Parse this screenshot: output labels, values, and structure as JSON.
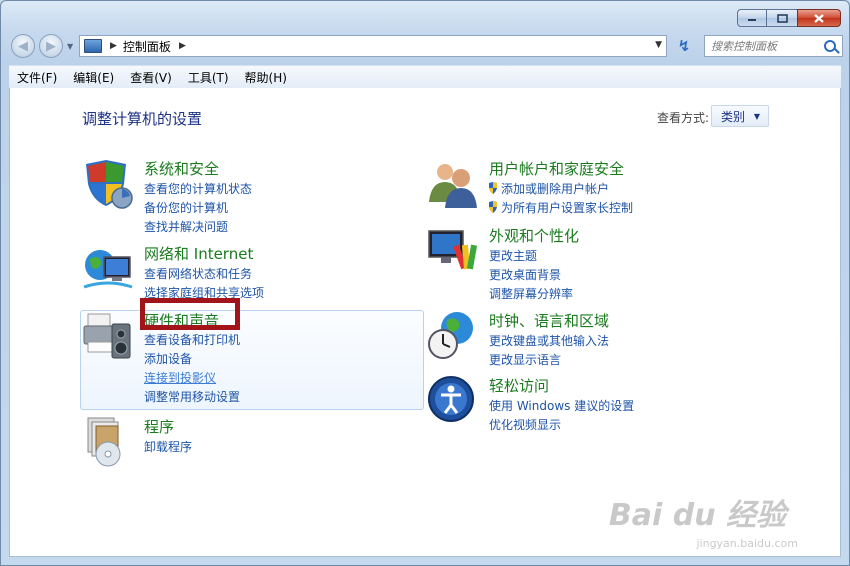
{
  "nav": {
    "breadcrumb": "控制面板",
    "search_placeholder": "搜索控制面板"
  },
  "menu": [
    "文件(F)",
    "编辑(E)",
    "查看(V)",
    "工具(T)",
    "帮助(H)"
  ],
  "main": {
    "title": "调整计算机的设置",
    "view_label": "查看方式:",
    "view_value": "类别"
  },
  "categories": {
    "security": {
      "title": "系统和安全",
      "links": [
        "查看您的计算机状态",
        "备份您的计算机",
        "查找并解决问题"
      ]
    },
    "network": {
      "title": "网络和 Internet",
      "links": [
        "查看网络状态和任务",
        "选择家庭组和共享选项"
      ]
    },
    "hardware": {
      "title": "硬件和声音",
      "links": [
        "查看设备和打印机",
        "添加设备",
        "连接到投影仪",
        "调整常用移动设置"
      ]
    },
    "programs": {
      "title": "程序",
      "links": [
        "卸载程序"
      ]
    },
    "users": {
      "title": "用户帐户和家庭安全",
      "links": [
        "添加或删除用户帐户",
        "为所有用户设置家长控制"
      ]
    },
    "appearance": {
      "title": "外观和个性化",
      "links": [
        "更改主题",
        "更改桌面背景",
        "调整屏幕分辨率"
      ]
    },
    "clock": {
      "title": "时钟、语言和区域",
      "links": [
        "更改键盘或其他输入法",
        "更改显示语言"
      ]
    },
    "ease": {
      "title": "轻松访问",
      "links": [
        "使用 Windows 建议的设置",
        "优化视频显示"
      ]
    }
  },
  "watermark": {
    "brand": "Bai du 经验",
    "url": "jingyan.baidu.com"
  },
  "colors": {
    "category_title": "#1a7b1e",
    "link": "#1e54a8",
    "highlight_border": "#a3141a"
  }
}
